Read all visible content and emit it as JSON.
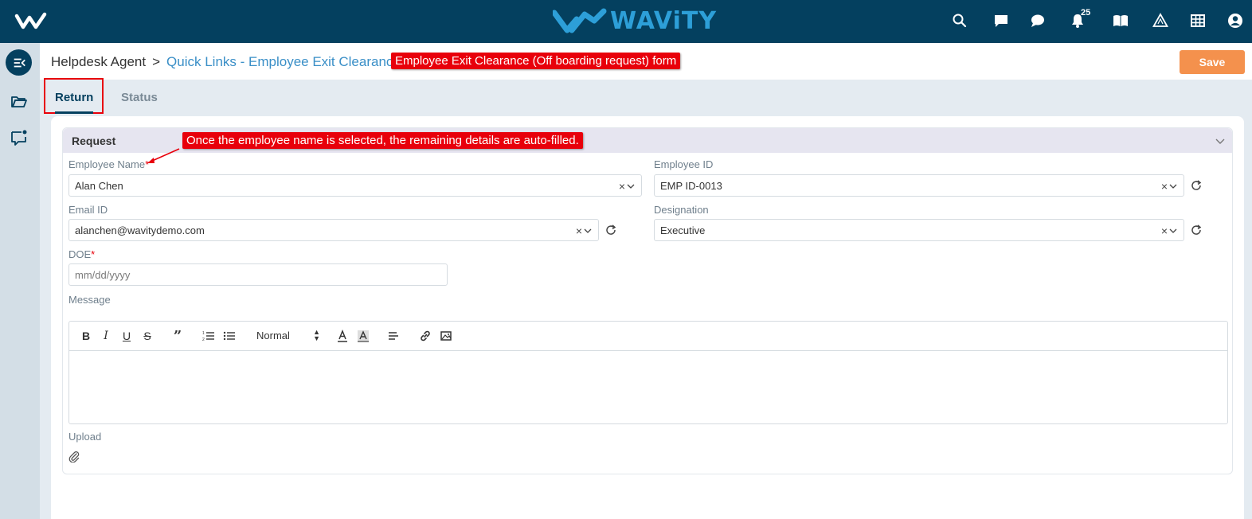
{
  "topbar": {
    "brand_name": "WAViTY",
    "brand_color": "#2d9fd8",
    "bg_color": "#04405f",
    "icons": [
      "search-icon",
      "chat-icon",
      "comment-icon",
      "bell-icon",
      "book-icon",
      "triangle-icon",
      "grid-icon",
      "user-icon"
    ],
    "notification_count": "25"
  },
  "rail": {
    "icons": [
      "collapse-menu-icon",
      "folder-icon",
      "feedback-icon"
    ]
  },
  "header": {
    "breadcrumb_root": "Helpdesk Agent",
    "breadcrumb_sep": ">",
    "breadcrumb_current": "Quick Links - Employee Exit Clearance",
    "annotation": "Employee Exit Clearance (Off boarding request) form",
    "save_label": "Save"
  },
  "tabs": [
    {
      "label": "Return",
      "active": true
    },
    {
      "label": "Status",
      "active": false
    }
  ],
  "panel": {
    "title": "Request",
    "annotation": "Once the employee name is selected, the remaining details are auto-filled."
  },
  "form": {
    "employee_name": {
      "label": "Employee Name",
      "required": "*",
      "value": "Alan Chen"
    },
    "employee_id": {
      "label": "Employee ID",
      "value": "EMP ID-0013"
    },
    "email_id": {
      "label": "Email ID",
      "value": "alanchen@wavitydemo.com"
    },
    "designation": {
      "label": "Designation",
      "value": "Executive"
    },
    "doe": {
      "label": "DOE",
      "required": "*",
      "placeholder": "mm/dd/yyyy"
    },
    "message": {
      "label": "Message",
      "font_size": "Normal",
      "value": ""
    },
    "upload": {
      "label": "Upload"
    },
    "clear_symbol": "×"
  },
  "colors": {
    "annotation_red": "#e8000b",
    "save_orange": "#f4914d",
    "link_blue": "#3a8fc7"
  }
}
